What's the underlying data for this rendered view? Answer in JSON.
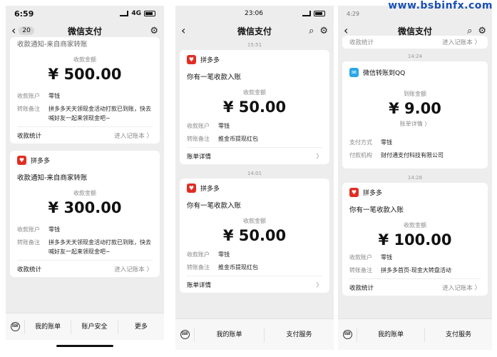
{
  "watermark": "www.bsbinfx.com",
  "phone1": {
    "time": "6:59",
    "network": "4G",
    "title": "微信支付",
    "badge": "20",
    "card1": {
      "notice": "收款通知-来自商家转账",
      "amount_label": "收款金额",
      "amount": "¥ 500.00",
      "acct_k": "收款账户",
      "acct_v": "零钱",
      "note_k": "转账备注",
      "note_v": "拼多多天天领现金活动打款已到账，快去喊好友一起来领现金吧~",
      "foot_l": "收款统计",
      "foot_r": "进入记账本 〉"
    },
    "card2": {
      "brand": "拼多多",
      "notice": "收款通知-来自商家转账",
      "amount_label": "收款金额",
      "amount": "¥ 300.00",
      "acct_k": "收款账户",
      "acct_v": "零钱",
      "note_k": "转账备注",
      "note_v": "拼多多天天领现金活动打款已到账，快去喊好友一起来领现金吧~",
      "foot_l": "收款统计",
      "foot_r": "进入记账本 〉"
    },
    "tabs": [
      "我的账单",
      "账户安全",
      "更多"
    ]
  },
  "phone2": {
    "time": "23:06",
    "title": "微信支付",
    "ts1": "15:51",
    "card1": {
      "brand": "拼多多",
      "notice": "你有一笔收款入账",
      "amount_label": "收款金额",
      "amount": "¥ 50.00",
      "acct_k": "收款账户",
      "acct_v": "零钱",
      "note_k": "转账备注",
      "note_v": "推金币提现红包",
      "foot_l": "账单详情",
      "foot_r": "〉"
    },
    "ts2": "14:01",
    "card2": {
      "brand": "拼多多",
      "notice": "你有一笔收款入账",
      "amount_label": "收款金额",
      "amount": "¥ 50.00",
      "acct_k": "收款账户",
      "acct_v": "零钱",
      "note_k": "转账备注",
      "note_v": "推金币提现红包",
      "foot_l": "账单详情",
      "foot_r": "〉"
    },
    "tabs": [
      "我的账单",
      "支付服务"
    ]
  },
  "phone3": {
    "time": "4:29",
    "title": "微信支付",
    "top_l": "收款统计",
    "top_r": "进入记账本 〉",
    "ts1": "14:24",
    "card1": {
      "brand": "微信转账到QQ",
      "amount_label": "到账金额",
      "amount": "¥ 9.00",
      "detail": "账单详情 〉",
      "method_k": "支付方式",
      "method_v": "零钱",
      "org_k": "付款机构",
      "org_v": "财付通支付科技有限公司"
    },
    "ts2": "14:28",
    "card2": {
      "brand": "拼多多",
      "notice": "你有一笔收款入账",
      "amount_label": "收款金额",
      "amount": "¥ 100.00",
      "acct_k": "收款账户",
      "acct_v": "零钱",
      "note_k": "转账备注",
      "note_v": "拼多多首页-现金大转盘活动",
      "foot_l": "收款统计",
      "foot_r": "进入记账本 〉"
    },
    "tabs": [
      "我的账单",
      "支付服务"
    ]
  }
}
